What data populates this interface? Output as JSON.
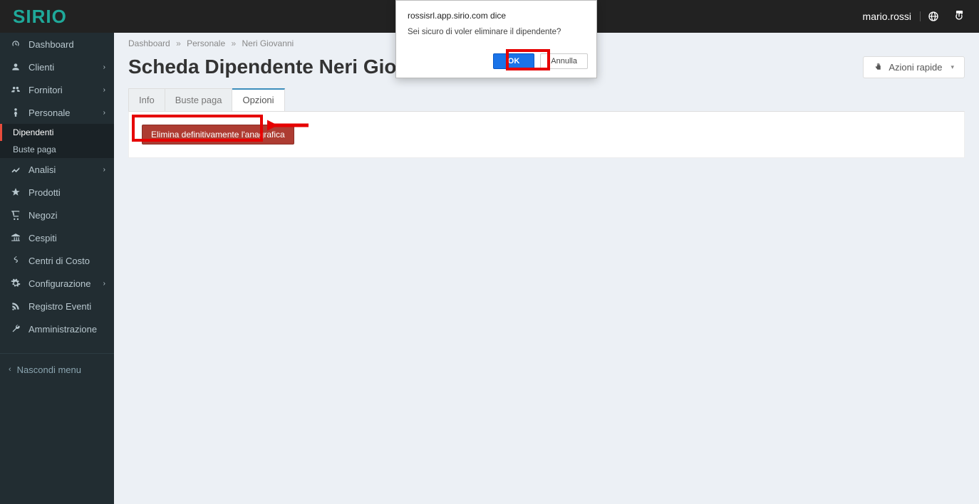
{
  "brand": "SIRIO",
  "header": {
    "user": "mario.rossi"
  },
  "sidebar": {
    "items": [
      {
        "label": "Dashboard",
        "icon": "dashboard"
      },
      {
        "label": "Clienti",
        "icon": "user",
        "expandable": true
      },
      {
        "label": "Fornitori",
        "icon": "users",
        "expandable": true
      },
      {
        "label": "Personale",
        "icon": "person",
        "expandable": true,
        "children": [
          {
            "label": "Dipendenti",
            "active": true
          },
          {
            "label": "Buste paga"
          }
        ]
      },
      {
        "label": "Analisi",
        "icon": "chart",
        "expandable": true
      },
      {
        "label": "Prodotti",
        "icon": "star"
      },
      {
        "label": "Negozi",
        "icon": "cart"
      },
      {
        "label": "Cespiti",
        "icon": "bank"
      },
      {
        "label": "Centri di Costo",
        "icon": "dollar"
      },
      {
        "label": "Configurazione",
        "icon": "gear",
        "expandable": true
      },
      {
        "label": "Registro Eventi",
        "icon": "rss"
      },
      {
        "label": "Amministrazione",
        "icon": "wrench"
      }
    ],
    "hide_menu": "Nascondi menu"
  },
  "breadcrumb": {
    "parts": [
      "Dashboard",
      "Personale",
      "Neri Giovanni"
    ],
    "sep": "»"
  },
  "page": {
    "title": "Scheda Dipendente Neri Giovanni",
    "quick_actions": "Azioni rapide",
    "tabs": [
      {
        "label": "Info"
      },
      {
        "label": "Buste paga"
      },
      {
        "label": "Opzioni",
        "active": true
      }
    ],
    "delete_button": "Elimina definitivamente l'anagrafica"
  },
  "dialog": {
    "origin": "rossisrl.app.sirio.com dice",
    "text": "Sei sicuro di voler eliminare il dipendente?",
    "ok": "OK",
    "cancel": "Annulla"
  }
}
